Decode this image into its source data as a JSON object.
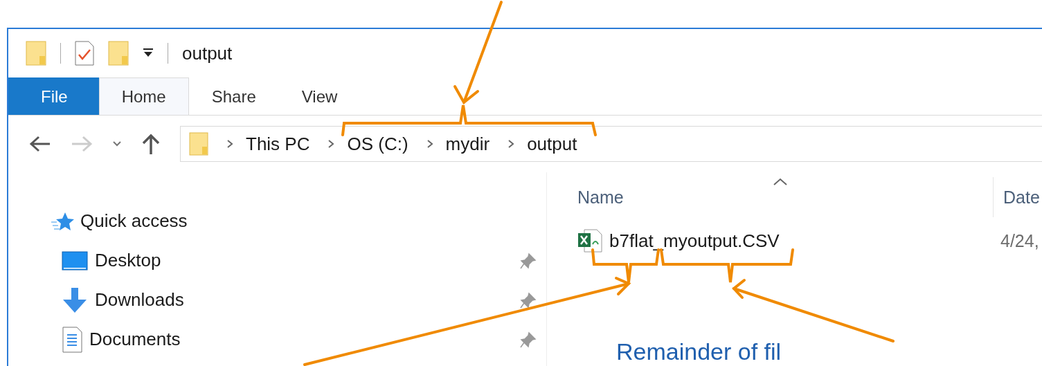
{
  "window": {
    "title": "output"
  },
  "ribbon_tabs": [
    {
      "label": "File",
      "kind": "file"
    },
    {
      "label": "Home",
      "kind": "tab",
      "selected": true
    },
    {
      "label": "Share",
      "kind": "tab",
      "selected": false
    },
    {
      "label": "View",
      "kind": "tab",
      "selected": false
    }
  ],
  "address_bar": {
    "breadcrumbs": [
      "This PC",
      "OS (C:)",
      "mydir",
      "output"
    ]
  },
  "navigation_pane": {
    "items": [
      {
        "label": "Quick access",
        "kind": "quick-access",
        "pinned": false
      },
      {
        "label": "Desktop",
        "kind": "desktop",
        "pinned": true
      },
      {
        "label": "Downloads",
        "kind": "downloads",
        "pinned": true
      },
      {
        "label": "Documents",
        "kind": "documents",
        "pinned": true
      }
    ]
  },
  "file_list": {
    "columns": [
      "Name",
      "Date"
    ],
    "rows": [
      {
        "name": "b7flat_myoutput.CSV",
        "date": "4/24,"
      }
    ]
  },
  "annotation": {
    "caption": "Remainder of fil"
  }
}
